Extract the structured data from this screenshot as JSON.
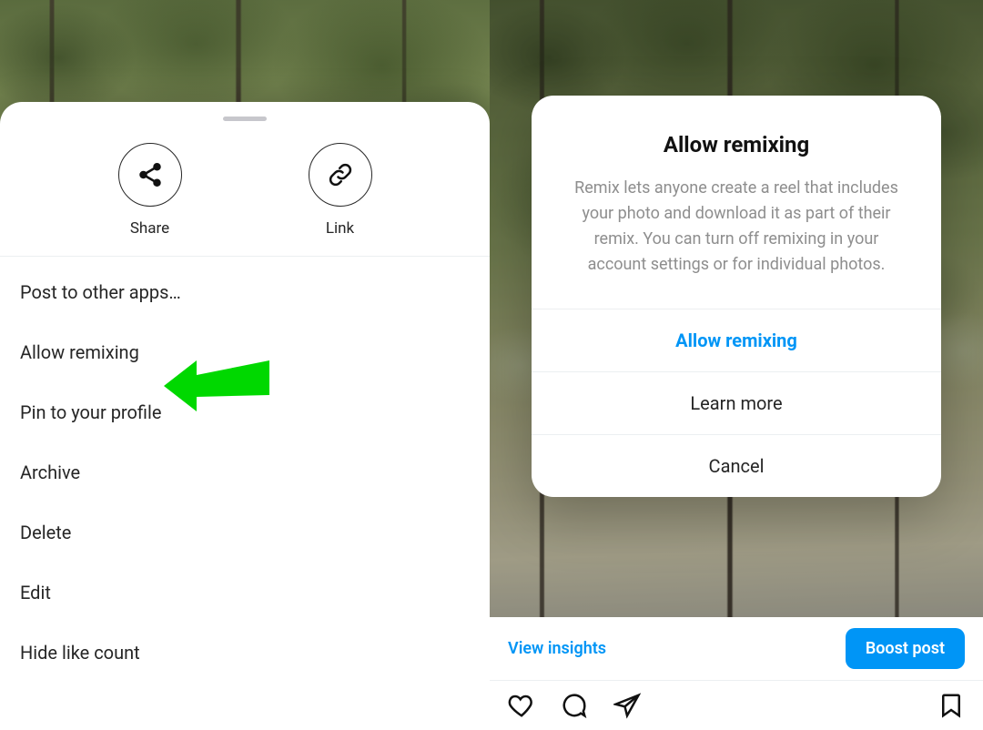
{
  "left": {
    "actions": {
      "share": {
        "label": "Share",
        "icon": "share-icon"
      },
      "link": {
        "label": "Link",
        "icon": "link-icon"
      }
    },
    "menu": {
      "post_other": "Post to other apps…",
      "allow_remixing": "Allow remixing",
      "pin_profile": "Pin to your profile",
      "archive": "Archive",
      "delete": "Delete",
      "edit": "Edit",
      "hide_like": "Hide like count"
    },
    "arrow_color": "#00D800"
  },
  "right": {
    "dialog": {
      "title": "Allow remixing",
      "body": "Remix lets anyone create a reel that includes your photo and download it as part of their remix. You can turn off remixing in your account settings or for individual photos.",
      "primary": "Allow remixing",
      "learn_more": "Learn more",
      "cancel": "Cancel"
    },
    "post": {
      "insights": "View insights",
      "boost": "Boost post"
    }
  }
}
